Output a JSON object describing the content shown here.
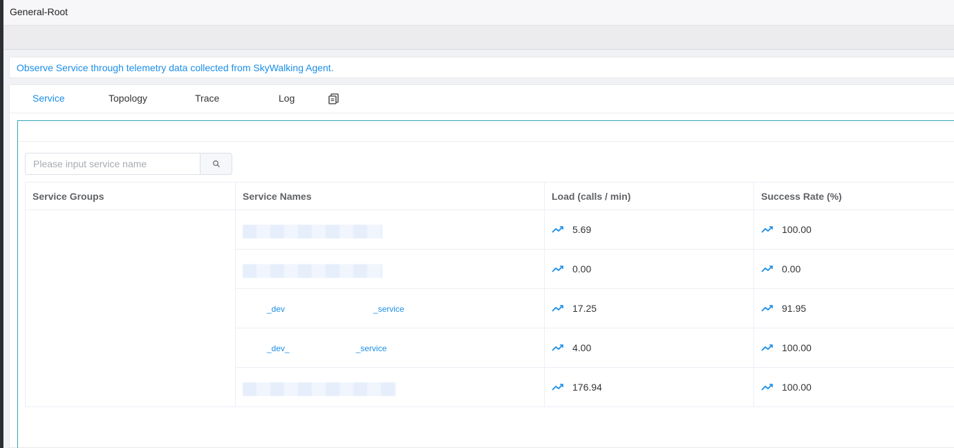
{
  "window": {
    "title": "General-Root"
  },
  "description": "Observe Service through telemetry data collected from SkyWalking Agent.",
  "tabs": [
    {
      "label": "Service",
      "active": true
    },
    {
      "label": "Topology",
      "active": false
    },
    {
      "label": "Trace",
      "active": false
    },
    {
      "label": "Log",
      "active": false
    }
  ],
  "tab_icon": "copy-icon",
  "search": {
    "placeholder": "Please input service name",
    "value": "",
    "icon": "search-icon"
  },
  "table": {
    "headers": [
      "Service Groups",
      "Service Names",
      "Load (calls / min)",
      "Success Rate (%)"
    ],
    "rows": [
      {
        "group": "",
        "name_prefix": "",
        "name_suffix": "",
        "load": "5.69",
        "success": "100.00"
      },
      {
        "group": "",
        "name_prefix": "",
        "name_suffix": "",
        "load": "0.00",
        "success": "0.00"
      },
      {
        "group": "",
        "name_prefix": "_dev",
        "name_suffix": "_service",
        "load": "17.25",
        "success": "91.95"
      },
      {
        "group": "",
        "name_prefix": "_dev_",
        "name_suffix": "_service",
        "load": "4.00",
        "success": "100.00"
      },
      {
        "group": "",
        "name_prefix": "",
        "name_suffix": "",
        "load": "176.94",
        "success": "100.00"
      }
    ]
  },
  "colors": {
    "accent": "#1a8ee8",
    "panel_border": "#2ea6b7"
  },
  "metric_icon": "trend-line-icon"
}
